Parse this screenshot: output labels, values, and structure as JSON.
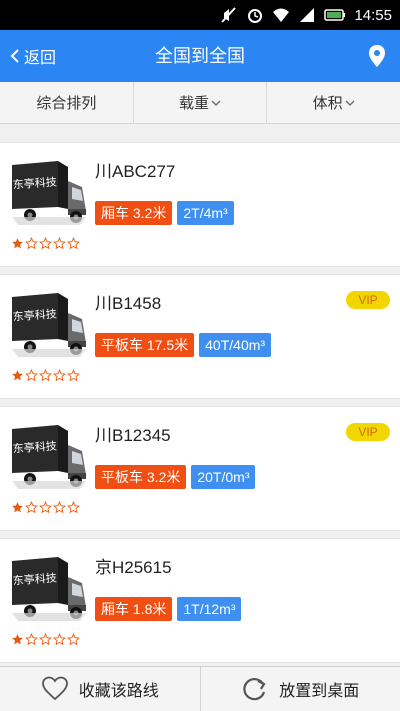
{
  "status_bar": {
    "time": "14:55"
  },
  "nav": {
    "back_label": "返回",
    "title": "全国到全国"
  },
  "filters": [
    {
      "label": "综合排列"
    },
    {
      "label": "载重"
    },
    {
      "label": "体积"
    }
  ],
  "vehicles": [
    {
      "plate": "川ABC277",
      "vip": "",
      "type": "厢车 3.2米",
      "capacity": "2T/4m³",
      "rating": 1,
      "logo_text": "东亭科技"
    },
    {
      "plate": "川B1458",
      "vip": "VIP",
      "type": "平板车  17.5米",
      "capacity": "40T/40m³",
      "rating": 1,
      "logo_text": "东亭科技"
    },
    {
      "plate": "川B12345",
      "vip": "VIP",
      "type": "平板车  3.2米",
      "capacity": "20T/0m³",
      "rating": 1,
      "logo_text": "东亭科技"
    },
    {
      "plate": "京H25615",
      "vip": "",
      "type": "厢车 1.8米",
      "capacity": "1T/12m³",
      "rating": 1,
      "logo_text": "东亭科技"
    }
  ],
  "bottom": {
    "favorite_label": "收藏该路线",
    "desktop_label": "放置到桌面"
  },
  "colors": {
    "nav": "#2b86f4",
    "type_tag": "#f04e12",
    "capacity_tag": "#3f8ff0",
    "vip": "#f2d600",
    "star": "#e85a10"
  }
}
